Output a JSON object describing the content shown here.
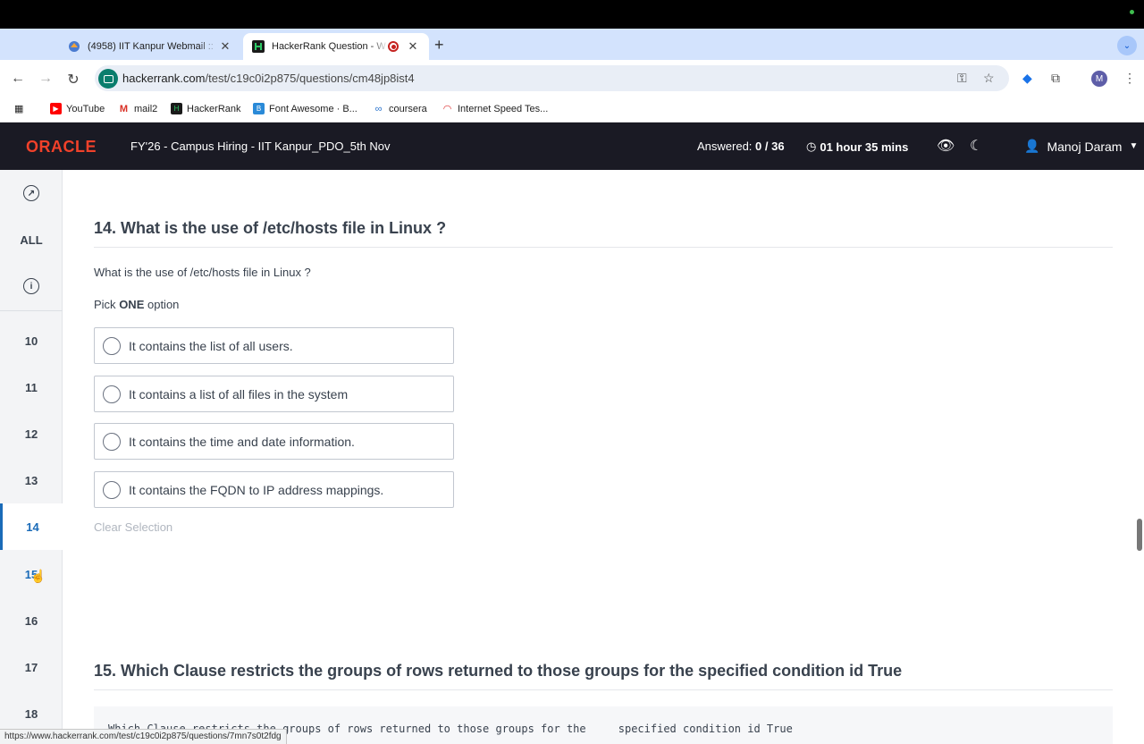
{
  "browser": {
    "tabs": [
      {
        "title": "(4958) IIT Kanpur Webmail ::",
        "active": false
      },
      {
        "title": "HackerRank Question - W",
        "active": true
      }
    ],
    "url_host": "hackerrank.com",
    "url_path": "/test/c19c0i2p875/questions/cm48jp8ist4",
    "profile_initial": "M",
    "bookmarks": [
      "YouTube",
      "mail2",
      "HackerRank",
      "Font Awesome · B...",
      "coursera",
      "Internet Speed Tes..."
    ],
    "status_url": "https://www.hackerrank.com/test/c19c0i2p875/questions/7mn7s0t2fdg"
  },
  "header": {
    "logo": "ORACLE",
    "test_title": "FY'26 - Campus Hiring - IIT Kanpur_PDO_5th Nov",
    "answered_label": "Answered:",
    "answered_value": "0 / 36",
    "timer": "01 hour 35 mins",
    "user_name": "Manoj Daram"
  },
  "sidebar": {
    "all_label": "ALL",
    "items": [
      "10",
      "11",
      "12",
      "13",
      "14",
      "15",
      "16",
      "17",
      "18"
    ],
    "active": "14"
  },
  "question": {
    "title": "14. What is the use of /etc/hosts file in Linux ?",
    "text": "What is the use of /etc/hosts file in Linux ?",
    "pick_prefix": "Pick",
    "pick_bold": "ONE",
    "pick_suffix": "option",
    "options": [
      "It contains the list of all users.",
      "It contains a list of all files in the system",
      "It contains the time and date information.",
      "It contains the FQDN to IP address mappings."
    ],
    "clear_label": "Clear Selection"
  },
  "next_question": {
    "title": "15. Which Clause restricts the groups of rows returned to those groups for the specified condition id True",
    "code_text": "Which Clause restricts the groups of rows returned to those groups for the     specified condition id True"
  }
}
